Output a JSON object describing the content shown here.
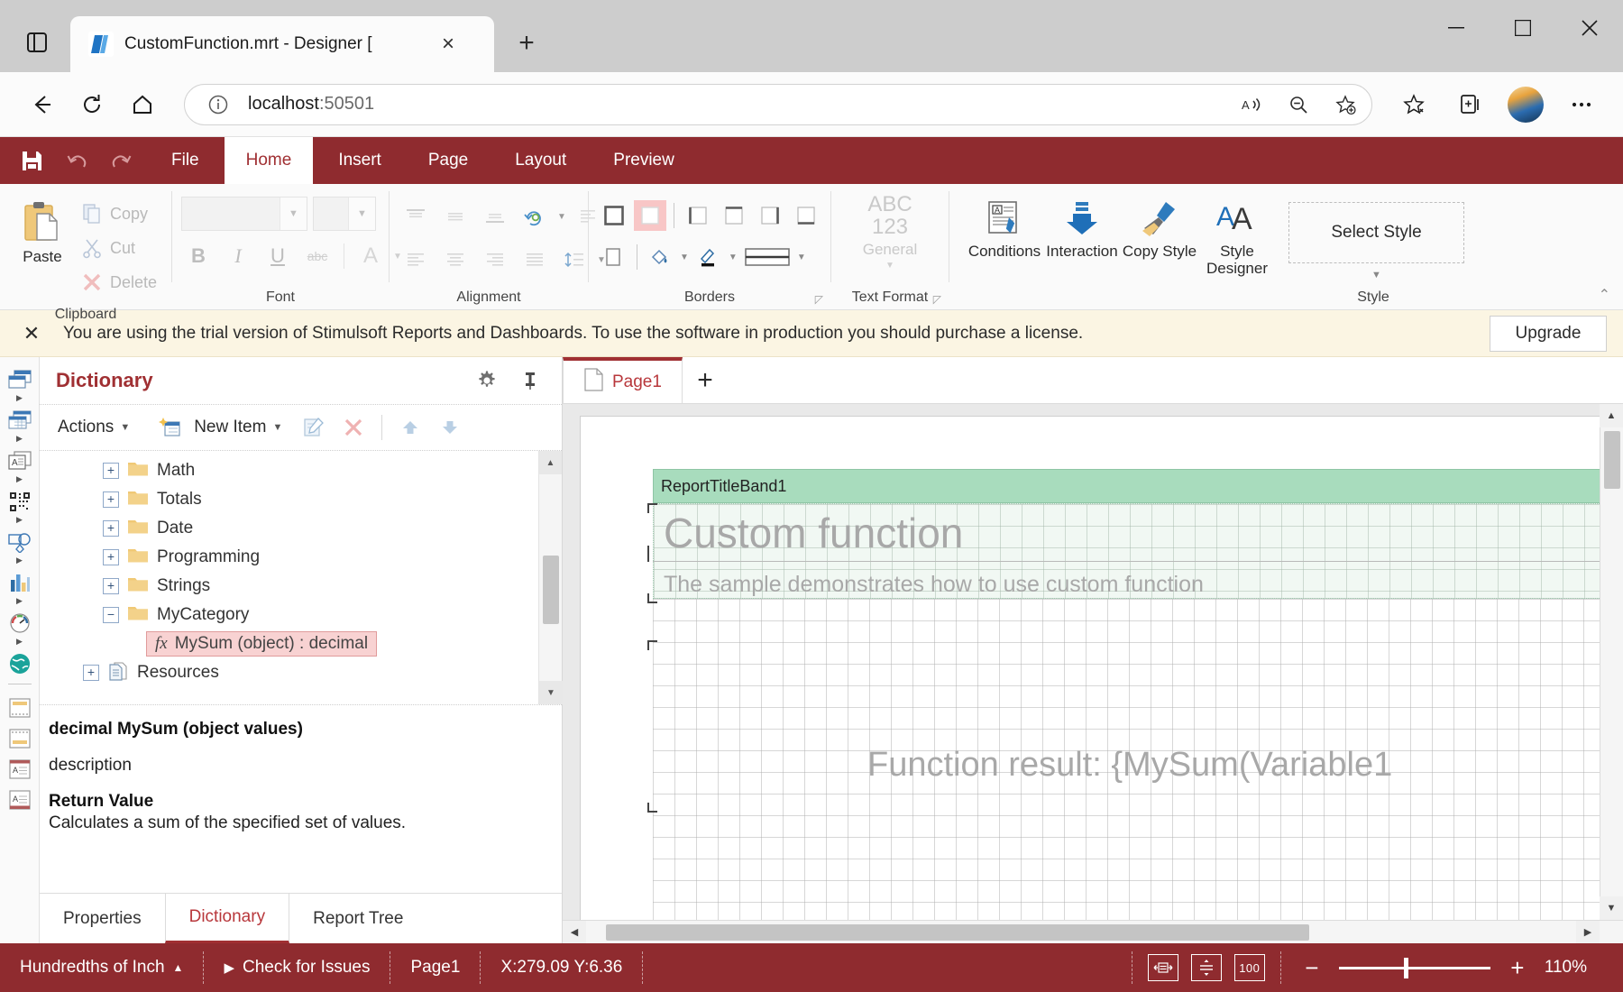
{
  "browser": {
    "tab": {
      "title": "CustomFunction.mrt - Designer [",
      "favicon": "stimulsoft-logo-icon",
      "close": "×"
    },
    "new_tab": "+",
    "window": {
      "minimize": "—",
      "maximize": "▢",
      "close": "✕"
    },
    "nav": {
      "back": "←",
      "reload": "⟳",
      "home": "⌂"
    },
    "address": {
      "value": "localhost",
      "port": ":50501",
      "full": "localhost:50501",
      "info_icon": "info-icon"
    },
    "omnibox_actions": [
      "read-aloud-icon",
      "zoom-out-icon",
      "add-favorite-icon"
    ],
    "toolbar_right": [
      "favorites-icon",
      "collections-icon",
      "profile-avatar",
      "settings-more-icon"
    ]
  },
  "ribbon": {
    "quick_access": [
      "save-icon",
      "undo-icon",
      "redo-icon"
    ],
    "tabs": [
      {
        "label": "File",
        "active": false
      },
      {
        "label": "Home",
        "active": true
      },
      {
        "label": "Insert",
        "active": false
      },
      {
        "label": "Page",
        "active": false
      },
      {
        "label": "Layout",
        "active": false
      },
      {
        "label": "Preview",
        "active": false
      }
    ],
    "groups": [
      {
        "label": "Clipboard"
      },
      {
        "label": "Font"
      },
      {
        "label": "Alignment"
      },
      {
        "label": "Borders"
      },
      {
        "label": "Text Format"
      },
      {
        "label": "Style"
      }
    ],
    "clipboard": {
      "paste": "Paste",
      "copy": "Copy",
      "cut": "Cut",
      "delete": "Delete"
    },
    "font": {
      "family_value": "",
      "size_value": "",
      "bold": "B",
      "italic": "I",
      "underline": "U",
      "strike": "abc",
      "color": "A"
    },
    "text_format": {
      "line1": "ABC",
      "line2": "123",
      "line3": "General"
    },
    "style": {
      "conditions": "Conditions",
      "interaction": "Interaction",
      "copy_style": "Copy Style",
      "style_designer": "Style Designer",
      "select_style": "Select Style"
    },
    "collapse": "⌃"
  },
  "trial": {
    "close": "✕",
    "message": "You are using the trial version of Stimulsoft Reports and Dashboards. To use the software in production you should purchase a license.",
    "upgrade": "Upgrade"
  },
  "toolstrip": {
    "items": [
      {
        "name": "panels-icon",
        "has_caret": true
      },
      {
        "name": "cross-tab-icon",
        "has_caret": true
      },
      {
        "name": "text-box-icon",
        "has_caret": true
      },
      {
        "name": "barcode-icon",
        "has_caret": true
      },
      {
        "name": "shapes-icon",
        "has_caret": true
      },
      {
        "name": "chart-icon",
        "has_caret": true
      },
      {
        "name": "gauge-icon",
        "has_caret": true
      },
      {
        "name": "map-icon",
        "has_caret": false
      },
      {
        "name": "header-band-icon",
        "has_caret": false
      },
      {
        "name": "footer-band-icon",
        "has_caret": false
      },
      {
        "name": "report-title-band-icon",
        "has_caret": false
      },
      {
        "name": "report-summary-band-icon",
        "has_caret": false
      }
    ]
  },
  "dictionary": {
    "title": "Dictionary",
    "header_icons": [
      "gear-icon",
      "pin-icon"
    ],
    "toolbar": {
      "actions": "Actions",
      "new_item": "New Item",
      "edit": "edit-icon",
      "delete": "delete-icon",
      "move_up": "move-up-icon",
      "move_down": "move-down-icon"
    },
    "tree": [
      {
        "label": "Math",
        "expander": "+",
        "type": "folder",
        "indent": 1
      },
      {
        "label": "Totals",
        "expander": "+",
        "type": "folder",
        "indent": 1
      },
      {
        "label": "Date",
        "expander": "+",
        "type": "folder",
        "indent": 1
      },
      {
        "label": "Programming",
        "expander": "+",
        "type": "folder",
        "indent": 1
      },
      {
        "label": "Strings",
        "expander": "+",
        "type": "folder",
        "indent": 1
      },
      {
        "label": "MyCategory",
        "expander": "−",
        "type": "folder",
        "indent": 1
      },
      {
        "label": "MySum (object) : decimal",
        "expander": "",
        "type": "function",
        "indent": 2,
        "selected": true
      },
      {
        "label": "Resources",
        "expander": "+",
        "type": "resources",
        "indent": 0
      }
    ],
    "description": {
      "signature": "decimal MySum (object values)",
      "text": "description",
      "return_title": "Return Value",
      "return_text": "Calculates a sum of the specified set of values."
    },
    "tabs": [
      {
        "label": "Properties",
        "active": false
      },
      {
        "label": "Dictionary",
        "active": true
      },
      {
        "label": "Report Tree",
        "active": false
      }
    ]
  },
  "designer": {
    "page_tabs": [
      {
        "label": "Page1",
        "active": true
      }
    ],
    "add_page": "+",
    "report": {
      "band_label": "ReportTitleBand1",
      "title": "Custom function",
      "subtitle": "The sample demonstrates how to use custom function",
      "result_text": "Function result: {MySum(Variable1"
    }
  },
  "statusbar": {
    "units": "Hundredths of Inch",
    "units_caret": "▲",
    "check_issues": "Check for Issues",
    "check_issues_icon": "play-icon",
    "page": "Page1",
    "coords": "X:279.09 Y:6.36",
    "view_buttons": [
      "fit-width-icon",
      "fit-page-icon",
      "zoom-100-icon"
    ],
    "zoom_minus": "−",
    "zoom_plus": "+",
    "zoom_value": "110%"
  },
  "colors": {
    "accent": "#8f2b2f",
    "accent_text": "#b8373b",
    "trial_bg": "#fbf5e3",
    "band_green": "#a8dcbd",
    "selection_pink": "#f8d2d2"
  }
}
